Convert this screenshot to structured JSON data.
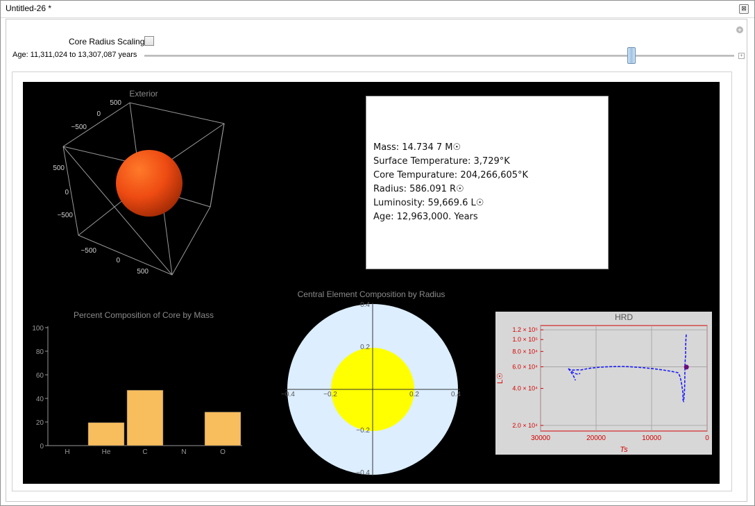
{
  "window": {
    "title": "Untitled-26 *",
    "close_glyph": "⊠"
  },
  "controls": {
    "core_radius_label": "Core Radius Scaling",
    "core_radius_checked": false,
    "age_label": "Age: 11,311,024 to 13,307,087 years",
    "age_slider_fraction": 0.825
  },
  "exterior": {
    "title": "Exterior",
    "ticks_top": [
      "500",
      "0",
      "−500"
    ],
    "ticks_left": [
      "500",
      "0",
      "−500"
    ],
    "ticks_bottom": [
      "−500",
      "0",
      "500"
    ],
    "sphere_color": "#e8501a"
  },
  "info": {
    "mass": "Mass: 14.734 7 M☉",
    "surface_temperature": "Surface Temperature: 3,729°K",
    "core_temperature": "Core Tempurature: 204,266,605°K",
    "radius": "Radius: 586.091 R☉",
    "luminosity": "Luminosity: 59,669.6 L☉",
    "age": "Age: 12,963,000. Years"
  },
  "composition": {
    "title": "Percent Composition of Core by Mass",
    "bar_color": "#f8bd5d",
    "chart_data": {
      "type": "bar",
      "categories": [
        "H",
        "He",
        "C",
        "N",
        "O"
      ],
      "values": [
        0,
        19.5,
        47,
        0,
        28.5
      ],
      "ylim": [
        0,
        100
      ],
      "yticks": [
        "0",
        "20",
        "40",
        "60",
        "80",
        "100"
      ]
    }
  },
  "central": {
    "title": "Central Element Composition by Radius",
    "outer_color": "#dceeff",
    "core_color": "#ffff00",
    "chart_data": {
      "type": "pie",
      "outer_radius": 0.41,
      "core_radius": 0.2,
      "xticks": [
        "−0.4",
        "−0.2",
        "0.2",
        "0.4"
      ],
      "yticks": [
        "0.4",
        "0.2",
        "−0.2",
        "−0.4"
      ]
    }
  },
  "hrd": {
    "title": "HRD",
    "xlabel": "Ts",
    "ylabel": "L☉",
    "axis_color": "#d40000",
    "line_color": "#1a1aff",
    "point_color": "#6a0a7a",
    "chart_data": {
      "type": "line",
      "xlim": [
        30000,
        0
      ],
      "ylim": [
        18000,
        130000
      ],
      "log_y": true,
      "xticks": [
        "30000",
        "20000",
        "10000",
        "0"
      ],
      "yticks": [
        "1.2 × 10⁵",
        "1.0 × 10⁵",
        "8.0 × 10⁴",
        "6.0 × 10⁴",
        "4.0 × 10⁴",
        "2.0 × 10⁴"
      ],
      "point": {
        "x": 3729,
        "y": 59669.6
      }
    }
  }
}
